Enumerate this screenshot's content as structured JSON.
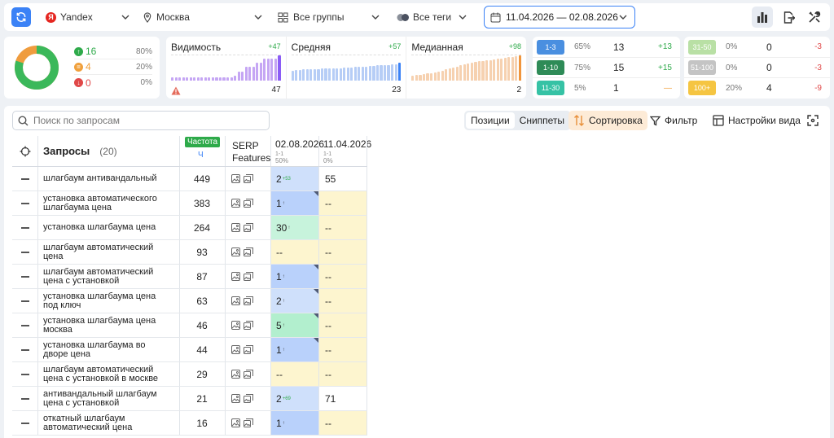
{
  "topbar": {
    "engine": "Yandex",
    "engine_logo": "Я",
    "region": "Москва",
    "groups": "Все группы",
    "tags": "Все теги",
    "date_range": "11.04.2026 — 02.08.2026"
  },
  "summary": {
    "up": {
      "count": "16",
      "pct": "80%",
      "color": "#2eaa4a"
    },
    "same": {
      "count": "4",
      "pct": "20%",
      "color": "#f0a03c"
    },
    "down": {
      "count": "0",
      "pct": "0%",
      "color": "#e04848"
    }
  },
  "metrics": [
    {
      "title": "Видимость",
      "delta": "+47",
      "value": "47",
      "color": "#c5a6f4",
      "accent": "#8b5cf6",
      "bars": [
        14,
        14,
        14,
        14,
        14,
        14,
        14,
        14,
        14,
        14,
        14,
        14,
        14,
        14,
        14,
        14,
        14,
        20,
        34,
        34,
        55,
        55,
        55,
        72,
        72,
        88,
        88,
        88,
        88,
        100
      ]
    },
    {
      "title": "Средняя",
      "delta": "+57",
      "value": "23",
      "color": "#b6cdf6",
      "accent": "#3b82f6",
      "bars": [
        40,
        42,
        42,
        44,
        44,
        44,
        46,
        46,
        48,
        48,
        48,
        50,
        50,
        50,
        52,
        52,
        52,
        54,
        54,
        56,
        56,
        58,
        58,
        60,
        60,
        62,
        62,
        64,
        64,
        70
      ]
    },
    {
      "title": "Медианная",
      "delta": "+98",
      "value": "2",
      "color": "#f6d1b0",
      "accent": "#f0953c",
      "bars": [
        20,
        22,
        24,
        26,
        28,
        30,
        32,
        36,
        40,
        44,
        48,
        52,
        56,
        60,
        64,
        68,
        72,
        74,
        76,
        78,
        80,
        82,
        84,
        86,
        88,
        90,
        92,
        94,
        96,
        100
      ]
    }
  ],
  "ranges_left": [
    {
      "label": "1-3",
      "pct": "65%",
      "count": "13",
      "change": "+13",
      "badge": "#4a8fe0",
      "chg_color": "#2eaa4a"
    },
    {
      "label": "1-10",
      "pct": "75%",
      "count": "15",
      "change": "+15",
      "badge": "#2e8b57",
      "chg_color": "#2eaa4a"
    },
    {
      "label": "11-30",
      "pct": "5%",
      "count": "1",
      "change": "—",
      "badge": "#36c2a5",
      "chg_color": "#f0a03c"
    }
  ],
  "ranges_right": [
    {
      "label": "31-50",
      "pct": "0%",
      "count": "0",
      "change": "-3",
      "badge": "#b9e0a5",
      "chg_color": "#e04848"
    },
    {
      "label": "51-100",
      "pct": "0%",
      "count": "0",
      "change": "-3",
      "badge": "#c4c4c4",
      "chg_color": "#e04848"
    },
    {
      "label": "100+",
      "pct": "20%",
      "count": "4",
      "change": "-9",
      "badge": "#f5c542",
      "chg_color": "#e04848"
    }
  ],
  "toolbar": {
    "search_placeholder": "Поиск по запросам",
    "tab_positions": "Позиции",
    "tab_snippets": "Сниппеты",
    "sort": "Сортировка",
    "filter": "Фильтр",
    "view_settings": "Настройки вида"
  },
  "table": {
    "title": "Запросы",
    "count": "(20)",
    "freq_label": "Частота",
    "freq_sub": "Ч",
    "serp_label_1": "SERP",
    "serp_label_2": "Features",
    "col1_date": "02.08.2026",
    "col1_range": "1-1",
    "col1_pct": "50%",
    "col2_date": "11.04.2026",
    "col2_range": "1-1",
    "col2_pct": "0%",
    "rows": [
      {
        "q1": "шлагбаум антивандальный",
        "q2": "",
        "freq": "449",
        "p1": "2",
        "p1_sup": "+53",
        "p1_bg": "bg-blue",
        "p1_corner": false,
        "p2": "55",
        "p2_bg": "bg-white"
      },
      {
        "q1": "установка автоматического",
        "q2": "шлагбаума цена",
        "freq": "383",
        "p1": "1",
        "p1_sup": "↑",
        "p1_bg": "bg-blue2",
        "p1_corner": true,
        "p2": "--",
        "p2_bg": "bg-yellow"
      },
      {
        "q1": "установка шлагбаума цена",
        "q2": "",
        "freq": "264",
        "p1": "30",
        "p1_sup": "↑",
        "p1_bg": "bg-green",
        "p1_corner": false,
        "p2": "--",
        "p2_bg": "bg-yellow"
      },
      {
        "q1": "шлагбаум автоматический",
        "q2": "цена",
        "freq": "93",
        "p1": "--",
        "p1_sup": "",
        "p1_bg": "bg-yellow",
        "p1_corner": false,
        "p2": "--",
        "p2_bg": "bg-yellow"
      },
      {
        "q1": "шлагбаум автоматический",
        "q2": "цена с установкой",
        "freq": "87",
        "p1": "1",
        "p1_sup": "↑",
        "p1_bg": "bg-blue2",
        "p1_corner": true,
        "p2": "--",
        "p2_bg": "bg-yellow"
      },
      {
        "q1": "установка шлагбаума цена",
        "q2": "под ключ",
        "freq": "63",
        "p1": "2",
        "p1_sup": "↑",
        "p1_bg": "bg-blue",
        "p1_corner": true,
        "p2": "--",
        "p2_bg": "bg-yellow"
      },
      {
        "q1": "установка шлагбаума цена",
        "q2": "москва",
        "freq": "46",
        "p1": "5",
        "p1_sup": "↑",
        "p1_bg": "bg-green2",
        "p1_corner": true,
        "p2": "--",
        "p2_bg": "bg-yellow"
      },
      {
        "q1": "установка шлагбаума во",
        "q2": "дворе цена",
        "freq": "44",
        "p1": "1",
        "p1_sup": "↑",
        "p1_bg": "bg-blue2",
        "p1_corner": true,
        "p2": "--",
        "p2_bg": "bg-yellow"
      },
      {
        "q1": "шлагбаум автоматический",
        "q2": "цена с установкой в москве",
        "freq": "29",
        "p1": "--",
        "p1_sup": "",
        "p1_bg": "bg-yellow",
        "p1_corner": false,
        "p2": "--",
        "p2_bg": "bg-yellow"
      },
      {
        "q1": "антивандальный шлагбаум",
        "q2": "цена с установкой",
        "freq": "21",
        "p1": "2",
        "p1_sup": "+69",
        "p1_bg": "bg-blue",
        "p1_corner": false,
        "p2": "71",
        "p2_bg": "bg-white"
      },
      {
        "q1": "откатный шлагбаум",
        "q2": "автоматический цена",
        "freq": "16",
        "p1": "1",
        "p1_sup": "↑",
        "p1_bg": "bg-blue2",
        "p1_corner": false,
        "p2": "--",
        "p2_bg": "bg-yellow"
      }
    ]
  }
}
